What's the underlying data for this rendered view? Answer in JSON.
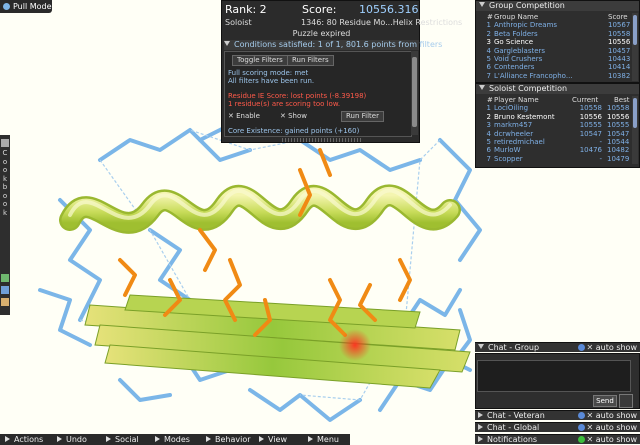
{
  "pull_mode": "Pull Mode",
  "score_panel": {
    "rank": "Rank: 2",
    "score_label": "Score:",
    "score_value": "10556.316",
    "mode": "Soloist",
    "puzzle": "1346: 80 Residue Mo...Helix Restrictions",
    "status": "Puzzle expired",
    "conditions": "Conditions satisfied: 1 of 1, 801.6 points from filters",
    "toggle_filters": "Toggle Filters",
    "run_filters": "Run Filters",
    "line_full_scoring": "Full scoring mode: met",
    "line_all_filters": "All filters have been run.",
    "residue_ie": "Residue IE Score: lost points (-8.39198)",
    "residues_low": "1 residue(s) are scoring too low.",
    "enable": "Enable",
    "show": "Show",
    "run_filter": "Run Filter",
    "core_existence": "Core Existence: gained points (+160)"
  },
  "group_competition": {
    "title": "Group Competition",
    "headers": {
      "rank": "#",
      "name": "Group Name",
      "score": "Score"
    },
    "rows": [
      {
        "rank": "1",
        "name": "Anthropic Dreams",
        "score": "10567"
      },
      {
        "rank": "2",
        "name": "Beta Folders",
        "score": "10558"
      },
      {
        "rank": "3",
        "name": "Go Science",
        "score": "10556"
      },
      {
        "rank": "4",
        "name": "Gargleblasters",
        "score": "10457"
      },
      {
        "rank": "5",
        "name": "Void Crushers",
        "score": "10443"
      },
      {
        "rank": "6",
        "name": "Contenders",
        "score": "10414"
      },
      {
        "rank": "7",
        "name": "L'Alliance Francopho...",
        "score": "10382"
      }
    ]
  },
  "soloist_competition": {
    "title": "Soloist Competition",
    "headers": {
      "rank": "#",
      "name": "Player Name",
      "current": "Current",
      "best": "Best"
    },
    "rows": [
      {
        "rank": "1",
        "name": "LociOiling",
        "current": "10558",
        "best": "10558"
      },
      {
        "rank": "2",
        "name": "Bruno Kestemont",
        "current": "10556",
        "best": "10556"
      },
      {
        "rank": "3",
        "name": "markm457",
        "current": "10555",
        "best": "10555"
      },
      {
        "rank": "4",
        "name": "dcrwheeler",
        "current": "10547",
        "best": "10547"
      },
      {
        "rank": "5",
        "name": "retiredmichael",
        "current": "-",
        "best": "10544"
      },
      {
        "rank": "6",
        "name": "MurloW",
        "current": "10476",
        "best": "10482"
      },
      {
        "rank": "7",
        "name": "Scopper",
        "current": "-",
        "best": "10479"
      }
    ]
  },
  "chat": {
    "group": "Chat - Group",
    "veteran": "Chat - Veteran",
    "global": "Chat - Global",
    "notifications": "Notifications",
    "auto_show": "auto show",
    "send": "Send"
  },
  "cookbook": {
    "label": "Cookbook",
    "letters": [
      "C",
      "o",
      "o",
      "k",
      "b",
      "o",
      "o",
      "k"
    ]
  },
  "bottom_menu": [
    "Actions",
    "Undo",
    "Social",
    "Modes",
    "Behavior",
    "View",
    "Menu"
  ],
  "colors": {
    "helix": "#dde87a",
    "sheet": "#9acc4a",
    "sidechain_blue": "#7bb6e8",
    "sidechain_orange": "#f08a14",
    "clash": "#ff3a2a",
    "accent_blue": "#9fd0ff"
  }
}
